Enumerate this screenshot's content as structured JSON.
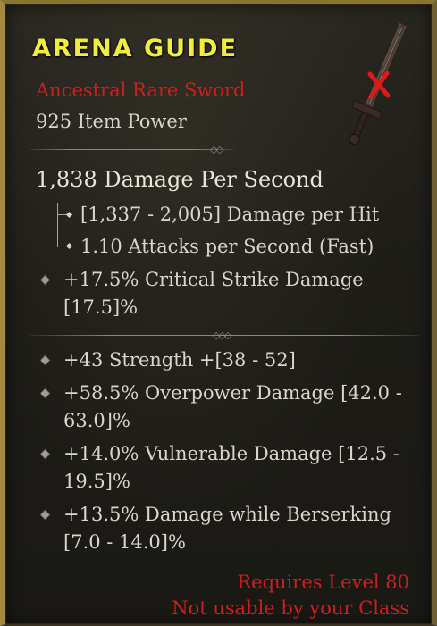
{
  "item": {
    "name": "ARENA GUIDE",
    "type": "Ancestral Rare Sword",
    "item_power": "925 Item Power",
    "dps": "1,838 Damage Per Second",
    "damage_per_hit": "[1,337 - 2,005] Damage per Hit",
    "attack_speed": "1.10 Attacks per Second (Fast)",
    "implicit": [
      "+17.5% Critical Strike Damage",
      "[17.5]%"
    ],
    "affixes": [
      [
        "+43 Strength +[38 - 52]"
      ],
      [
        "+58.5% Overpower Damage [42.0 -",
        "63.0]%"
      ],
      [
        "+14.0% Vulnerable Damage [12.5 -",
        "19.5]%"
      ],
      [
        "+13.5% Damage while Berserking",
        "[7.0 - 14.0]%"
      ]
    ],
    "requirement": "Requires Level 80",
    "class_warning": "Not usable by your Class"
  },
  "icons": {
    "item_icon": "sword-icon",
    "unusable_mark": "red-x-icon"
  },
  "colors": {
    "title": "#f2ec3c",
    "rarity_text": "#c8201d",
    "warning_text": "#cc201c",
    "border": "#a48a3e"
  }
}
